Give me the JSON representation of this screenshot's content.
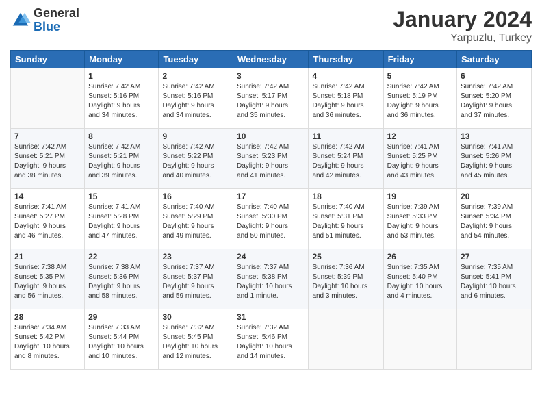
{
  "header": {
    "logo_general": "General",
    "logo_blue": "Blue",
    "month": "January 2024",
    "location": "Yarpuzlu, Turkey"
  },
  "days_of_week": [
    "Sunday",
    "Monday",
    "Tuesday",
    "Wednesday",
    "Thursday",
    "Friday",
    "Saturday"
  ],
  "weeks": [
    [
      {
        "day": "",
        "info": ""
      },
      {
        "day": "1",
        "info": "Sunrise: 7:42 AM\nSunset: 5:16 PM\nDaylight: 9 hours\nand 34 minutes."
      },
      {
        "day": "2",
        "info": "Sunrise: 7:42 AM\nSunset: 5:16 PM\nDaylight: 9 hours\nand 34 minutes."
      },
      {
        "day": "3",
        "info": "Sunrise: 7:42 AM\nSunset: 5:17 PM\nDaylight: 9 hours\nand 35 minutes."
      },
      {
        "day": "4",
        "info": "Sunrise: 7:42 AM\nSunset: 5:18 PM\nDaylight: 9 hours\nand 36 minutes."
      },
      {
        "day": "5",
        "info": "Sunrise: 7:42 AM\nSunset: 5:19 PM\nDaylight: 9 hours\nand 36 minutes."
      },
      {
        "day": "6",
        "info": "Sunrise: 7:42 AM\nSunset: 5:20 PM\nDaylight: 9 hours\nand 37 minutes."
      }
    ],
    [
      {
        "day": "7",
        "info": "Sunrise: 7:42 AM\nSunset: 5:21 PM\nDaylight: 9 hours\nand 38 minutes."
      },
      {
        "day": "8",
        "info": "Sunrise: 7:42 AM\nSunset: 5:21 PM\nDaylight: 9 hours\nand 39 minutes."
      },
      {
        "day": "9",
        "info": "Sunrise: 7:42 AM\nSunset: 5:22 PM\nDaylight: 9 hours\nand 40 minutes."
      },
      {
        "day": "10",
        "info": "Sunrise: 7:42 AM\nSunset: 5:23 PM\nDaylight: 9 hours\nand 41 minutes."
      },
      {
        "day": "11",
        "info": "Sunrise: 7:42 AM\nSunset: 5:24 PM\nDaylight: 9 hours\nand 42 minutes."
      },
      {
        "day": "12",
        "info": "Sunrise: 7:41 AM\nSunset: 5:25 PM\nDaylight: 9 hours\nand 43 minutes."
      },
      {
        "day": "13",
        "info": "Sunrise: 7:41 AM\nSunset: 5:26 PM\nDaylight: 9 hours\nand 45 minutes."
      }
    ],
    [
      {
        "day": "14",
        "info": "Sunrise: 7:41 AM\nSunset: 5:27 PM\nDaylight: 9 hours\nand 46 minutes."
      },
      {
        "day": "15",
        "info": "Sunrise: 7:41 AM\nSunset: 5:28 PM\nDaylight: 9 hours\nand 47 minutes."
      },
      {
        "day": "16",
        "info": "Sunrise: 7:40 AM\nSunset: 5:29 PM\nDaylight: 9 hours\nand 49 minutes."
      },
      {
        "day": "17",
        "info": "Sunrise: 7:40 AM\nSunset: 5:30 PM\nDaylight: 9 hours\nand 50 minutes."
      },
      {
        "day": "18",
        "info": "Sunrise: 7:40 AM\nSunset: 5:31 PM\nDaylight: 9 hours\nand 51 minutes."
      },
      {
        "day": "19",
        "info": "Sunrise: 7:39 AM\nSunset: 5:33 PM\nDaylight: 9 hours\nand 53 minutes."
      },
      {
        "day": "20",
        "info": "Sunrise: 7:39 AM\nSunset: 5:34 PM\nDaylight: 9 hours\nand 54 minutes."
      }
    ],
    [
      {
        "day": "21",
        "info": "Sunrise: 7:38 AM\nSunset: 5:35 PM\nDaylight: 9 hours\nand 56 minutes."
      },
      {
        "day": "22",
        "info": "Sunrise: 7:38 AM\nSunset: 5:36 PM\nDaylight: 9 hours\nand 58 minutes."
      },
      {
        "day": "23",
        "info": "Sunrise: 7:37 AM\nSunset: 5:37 PM\nDaylight: 9 hours\nand 59 minutes."
      },
      {
        "day": "24",
        "info": "Sunrise: 7:37 AM\nSunset: 5:38 PM\nDaylight: 10 hours\nand 1 minute."
      },
      {
        "day": "25",
        "info": "Sunrise: 7:36 AM\nSunset: 5:39 PM\nDaylight: 10 hours\nand 3 minutes."
      },
      {
        "day": "26",
        "info": "Sunrise: 7:35 AM\nSunset: 5:40 PM\nDaylight: 10 hours\nand 4 minutes."
      },
      {
        "day": "27",
        "info": "Sunrise: 7:35 AM\nSunset: 5:41 PM\nDaylight: 10 hours\nand 6 minutes."
      }
    ],
    [
      {
        "day": "28",
        "info": "Sunrise: 7:34 AM\nSunset: 5:42 PM\nDaylight: 10 hours\nand 8 minutes."
      },
      {
        "day": "29",
        "info": "Sunrise: 7:33 AM\nSunset: 5:44 PM\nDaylight: 10 hours\nand 10 minutes."
      },
      {
        "day": "30",
        "info": "Sunrise: 7:32 AM\nSunset: 5:45 PM\nDaylight: 10 hours\nand 12 minutes."
      },
      {
        "day": "31",
        "info": "Sunrise: 7:32 AM\nSunset: 5:46 PM\nDaylight: 10 hours\nand 14 minutes."
      },
      {
        "day": "",
        "info": ""
      },
      {
        "day": "",
        "info": ""
      },
      {
        "day": "",
        "info": ""
      }
    ]
  ]
}
